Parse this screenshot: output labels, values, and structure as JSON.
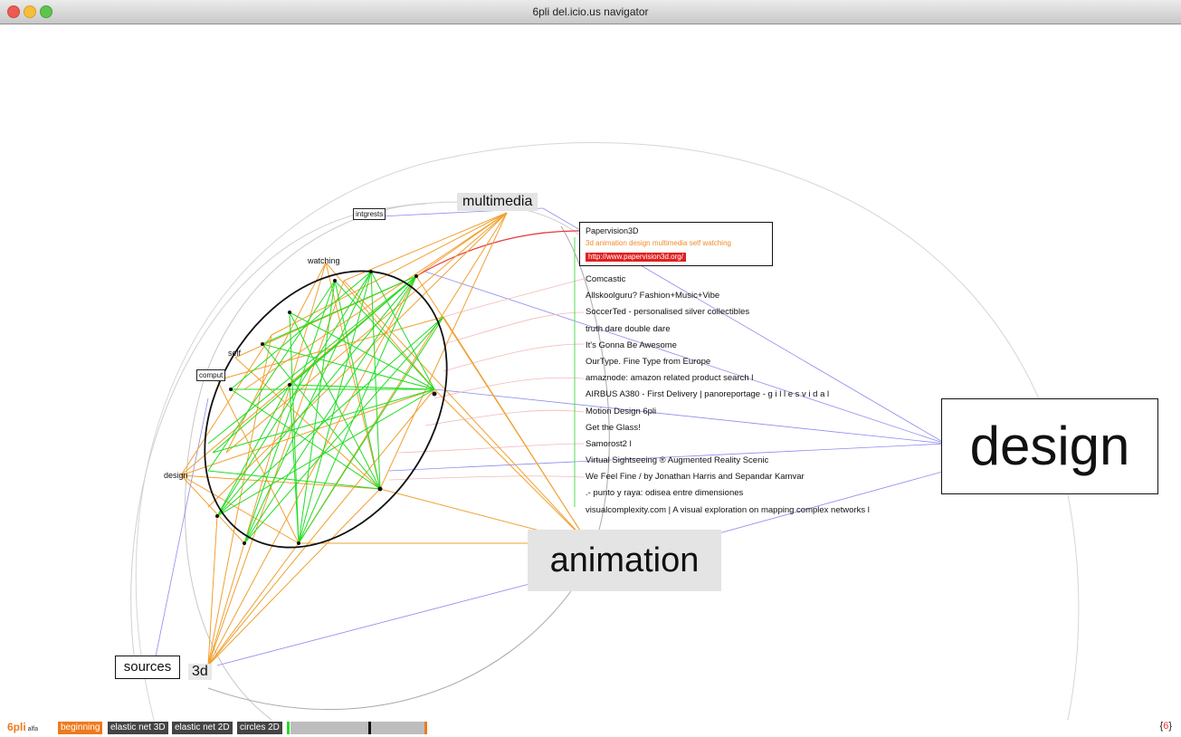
{
  "window": {
    "title": "6pli del.icio.us navigator"
  },
  "tags": {
    "multimedia": "multimedia",
    "interests": "intgrests",
    "watching": "watching",
    "self": "self",
    "computer": "comput",
    "design_small": "design",
    "design_big": "design",
    "animation": "animation",
    "sources": "sources",
    "three_d": "3d"
  },
  "popup": {
    "title": "Papervision3D",
    "tags": "3d  animation  design  multimedia  self  watching",
    "link": "http://www.papervision3d.org/"
  },
  "results": [
    "Comcastic",
    "Allskoolguru? Fashion+Music+Vibe",
    "SoccerTed - personalised silver collectibles",
    "truth dare double dare",
    "It's Gonna Be Awesome",
    "OurType. Fine Type from Europe",
    "amaznode: amazon related product search l",
    "AIRBUS A380 - First Delivery | panoreportage - g i l l e s v i d a l",
    "Motion Design 6pli",
    "Get the Glass!",
    "Samorost2 l",
    "Virtual Sightseeing ® Augmented Reality Scenic",
    "We Feel Fine / by Jonathan Harris and Sepandar Kamvar",
    ".- punto y raya: odisea entre dimensiones",
    "visualcomplexity.com | A visual exploration on mapping complex networks l"
  ],
  "toolbar": {
    "logo": "6pli",
    "logo_suffix": "alfa",
    "beginning": "beginning",
    "elastic_3d": "elastic net 3D",
    "elastic_2d": "elastic net 2D",
    "circles_2d": "circles 2D",
    "brace_left": "{",
    "brace_six": "6",
    "brace_right": "}"
  },
  "colors": {
    "orange": "#f0a030",
    "green": "#22dd22",
    "blue": "#8c8cf0",
    "red": "#e83a3a",
    "accent": "#ee7a1d"
  }
}
